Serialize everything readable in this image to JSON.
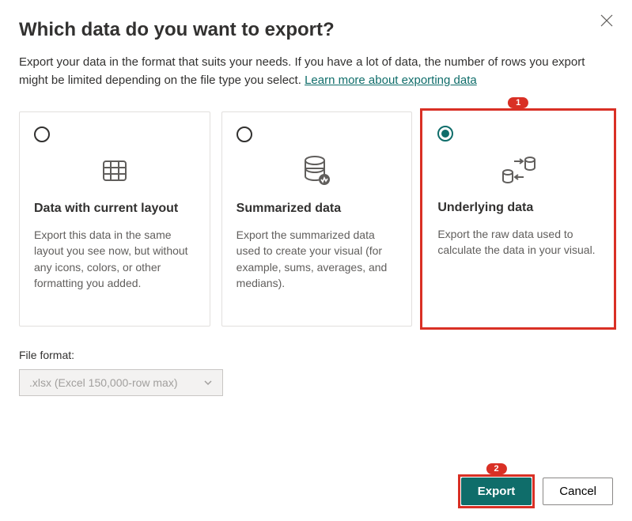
{
  "dialog": {
    "title": "Which data do you want to export?",
    "description_prefix": "Export your data in the format that suits your needs. If you have a lot of data, the number of rows you export might be limited depending on the file type you select.  ",
    "learn_more_link": "Learn more about exporting data"
  },
  "options": [
    {
      "key": "current-layout",
      "title": "Data with current layout",
      "description": "Export this data in the same layout you see now, but without any icons, colors, or other formatting you added.",
      "selected": false
    },
    {
      "key": "summarized",
      "title": "Summarized data",
      "description": "Export the summarized data used to create your visual (for example, sums, averages, and medians).",
      "selected": false
    },
    {
      "key": "underlying",
      "title": "Underlying data",
      "description": "Export the raw data used to calculate the data in your visual.",
      "selected": true
    }
  ],
  "file_format": {
    "label": "File format:",
    "value": ".xlsx (Excel 150,000-row max)"
  },
  "buttons": {
    "export": "Export",
    "cancel": "Cancel"
  },
  "annotations": {
    "badge1": "1",
    "badge2": "2"
  }
}
